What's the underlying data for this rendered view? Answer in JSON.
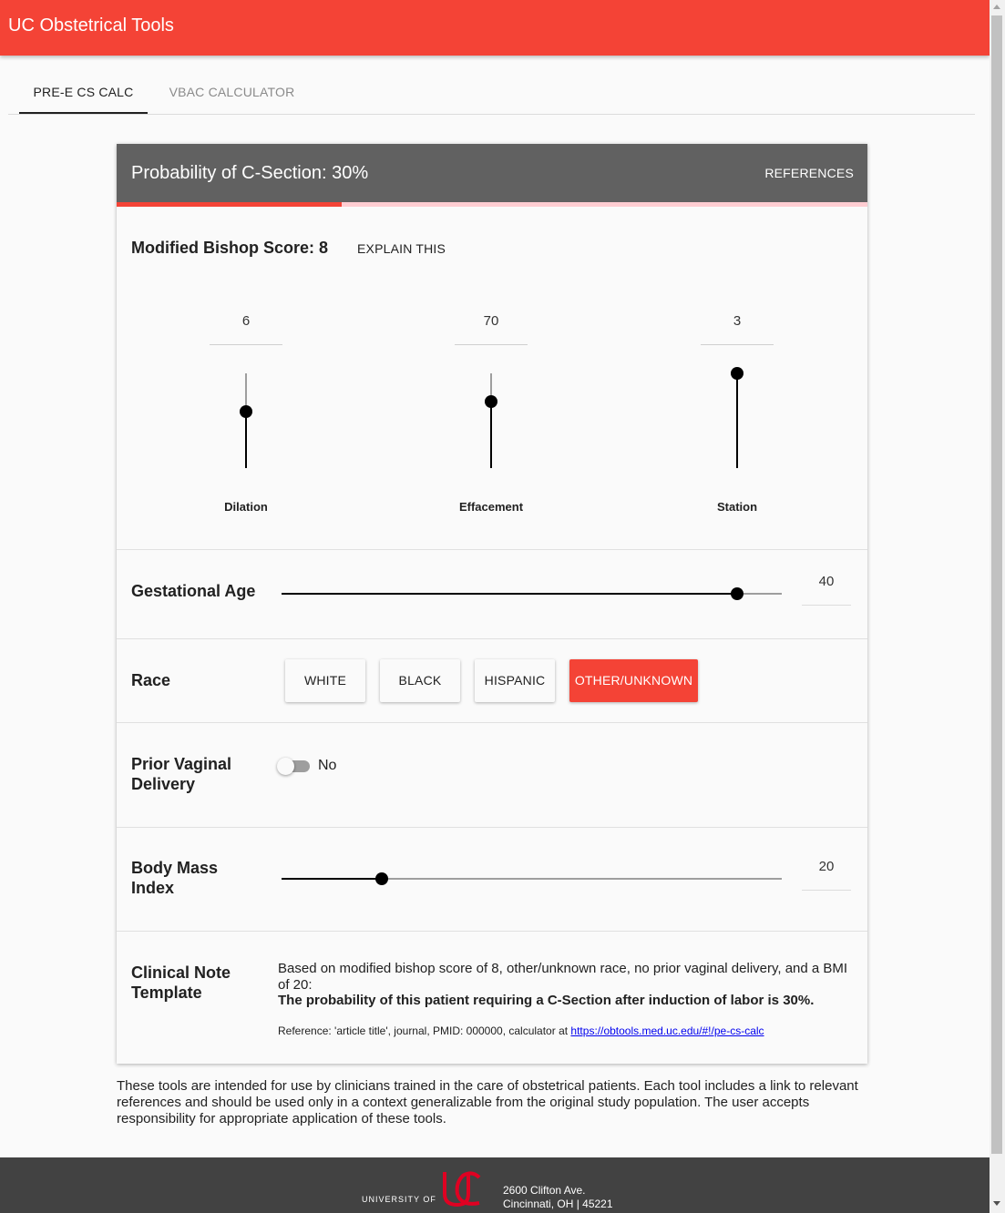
{
  "app": {
    "title": "UC Obstetrical Tools"
  },
  "tabs": [
    {
      "label": "PRE-E CS CALC",
      "active": true
    },
    {
      "label": "VBAC CALCULATOR",
      "active": false
    }
  ],
  "header": {
    "probability_title": "Probability of C-Section: 30%",
    "probability_value": 30,
    "references_label": "REFERENCES"
  },
  "bishop": {
    "title": "Modified Bishop Score: 8",
    "explain_label": "EXPLAIN THIS",
    "sliders": [
      {
        "label": "Dilation",
        "value": "6",
        "level": 0.6
      },
      {
        "label": "Effacement",
        "value": "70",
        "level": 0.7
      },
      {
        "label": "Station",
        "value": "3",
        "level": 1.0
      }
    ]
  },
  "gestational_age": {
    "label": "Gestational Age",
    "value": "40",
    "level": 0.91
  },
  "race": {
    "label": "Race",
    "options": [
      "WHITE",
      "BLACK",
      "HISPANIC",
      "OTHER/UNKNOWN"
    ],
    "selected": "OTHER/UNKNOWN"
  },
  "prior_vaginal": {
    "label": "Prior Vaginal Delivery",
    "toggle_text": "No",
    "checked": false
  },
  "bmi": {
    "label": "Body Mass Index",
    "value": "20",
    "level": 0.2
  },
  "clinical_note": {
    "label": "Clinical Note Template",
    "text": "Based on modified bishop score of 8, other/unknown race, no prior vaginal delivery, and a BMI of 20:",
    "bold": "The probability of this patient requiring a C-Section after induction of labor is 30%.",
    "ref_prefix": "Reference: 'article title', journal, PMID: 000000, calculator at",
    "ref_link": "https://obtools.med.uc.edu/#!/pe-cs-calc"
  },
  "disclaimer": "These tools are intended for use by clinicians trained in the care of obstetrical patients. Each tool includes a link to relevant references and should be used only in a context generalizable from the original study population. The user accepts responsibility for appropriate application of these tools.",
  "footer": {
    "logo_text": "UNIVERSITY OF",
    "address_line1": "2600 Clifton Ave.",
    "address_line2": "Cincinnati, OH | 45221"
  },
  "colors": {
    "accent": "#f44336",
    "header_gray": "#616161",
    "footer_gray": "#424242"
  },
  "icons": {
    "logo": "uc-logo-icon"
  }
}
